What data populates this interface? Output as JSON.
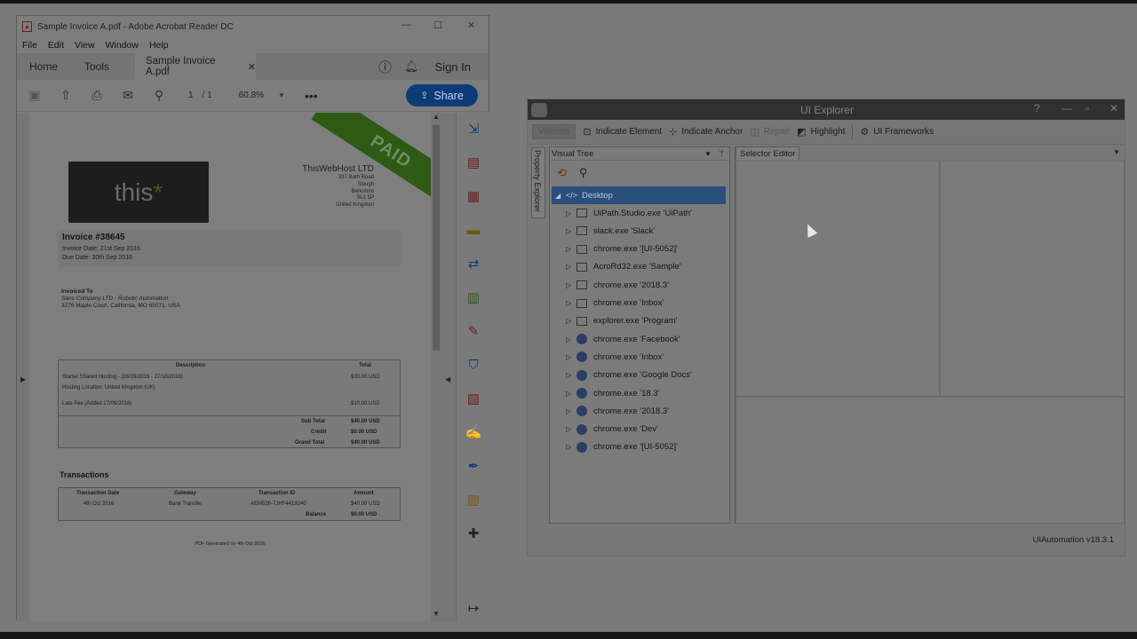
{
  "acrobat": {
    "title": "Sample Invoice A.pdf - Adobe Acrobat Reader DC",
    "menu": [
      "File",
      "Edit",
      "View",
      "Window",
      "Help"
    ],
    "nav_tabs": [
      "Home",
      "Tools"
    ],
    "doc_tab": "Sample Invoice A.pdf",
    "sign_in": "Sign In",
    "page_current": "1",
    "page_total": "/ 1",
    "zoom": "60.8%",
    "share": "Share",
    "invoice": {
      "paid_stamp": "PAID",
      "logo_text": "this",
      "logo_star": "*",
      "company_name": "ThisWebHost LTD",
      "company_lines": [
        "337 Bath Road",
        "Slough",
        "Berkshire",
        "SL1 5P",
        "United Kingdom"
      ],
      "invoice_number": "Invoice #38645",
      "invoice_date": "Invoice Date: 21st Sep 2016",
      "due_date": "Due Date: 20th Sep 2016",
      "invoiced_to_label": "Invoiced To",
      "invoiced_to_lines": [
        "Sans Company LTD - Robotic Automation",
        "3276 Maple Court, California, MO 65071, USA"
      ],
      "items_headers": [
        "Description",
        "Total"
      ],
      "items": [
        {
          "desc": "Starter Shared Hosting - (28/09/2016 - 27/10/2016)",
          "total": "$30.00 USD"
        },
        {
          "desc": "Hosting Location: United Kingdom (UK)",
          "total": ""
        },
        {
          "desc": "Late Fee (Added 27/09/2016)",
          "total": "$10.00 USD"
        }
      ],
      "totals": [
        {
          "label": "Sub Total",
          "value": "$40.00 USD"
        },
        {
          "label": "Credit",
          "value": "$0.00 USD"
        },
        {
          "label": "Grand Total",
          "value": "$40.00 USD"
        }
      ],
      "transactions_title": "Transactions",
      "trans_headers": [
        "Transaction Date",
        "Gateway",
        "Transaction ID",
        "Amount"
      ],
      "trans_row": [
        "4th Oct 2016",
        "Bank Transfer",
        "AEM536-7JHF4419240",
        "$40.00 USD"
      ],
      "balance_label": "Balance",
      "balance_value": "$0.00 USD",
      "footer": "PDF Generated on 4th Oct 2016"
    }
  },
  "uiexplorer": {
    "title": "UI Explorer",
    "toolbar": [
      "Validate",
      "Indicate Element",
      "Indicate Anchor",
      "Repair",
      "Highlight",
      "UI Frameworks"
    ],
    "side_tab": "Property Explorer",
    "visual_tree_label": "Visual Tree",
    "selector_editor_label": "Selector Editor",
    "root_node": "Desktop",
    "nodes": [
      {
        "label": "UiPath.Studio.exe 'UiPath'",
        "icon": "window-icon"
      },
      {
        "label": "slack.exe 'Slack'",
        "icon": "window-icon"
      },
      {
        "label": "chrome.exe '[UI-5052]'",
        "icon": "window-icon"
      },
      {
        "label": "AcroRd32.exe 'Sample'",
        "icon": "window-icon"
      },
      {
        "label": "chrome.exe '2018.3'",
        "icon": "window-icon"
      },
      {
        "label": "chrome.exe 'Inbox'",
        "icon": "window-icon"
      },
      {
        "label": "explorer.exe 'Program'",
        "icon": "window-icon"
      },
      {
        "label": "chrome.exe 'Facebook'",
        "icon": "globe-icon"
      },
      {
        "label": "chrome.exe 'Inbox'",
        "icon": "globe-icon"
      },
      {
        "label": "chrome.exe 'Google Docs'",
        "icon": "globe-icon"
      },
      {
        "label": "chrome.exe '18.3'",
        "icon": "globe-icon"
      },
      {
        "label": "chrome.exe '2018.3'",
        "icon": "globe-icon"
      },
      {
        "label": "chrome.exe 'Dev'",
        "icon": "globe-icon"
      },
      {
        "label": "chrome.exe '[UI-5052]'",
        "icon": "globe-icon"
      }
    ],
    "version": "UIAutomation v18.3.1"
  }
}
